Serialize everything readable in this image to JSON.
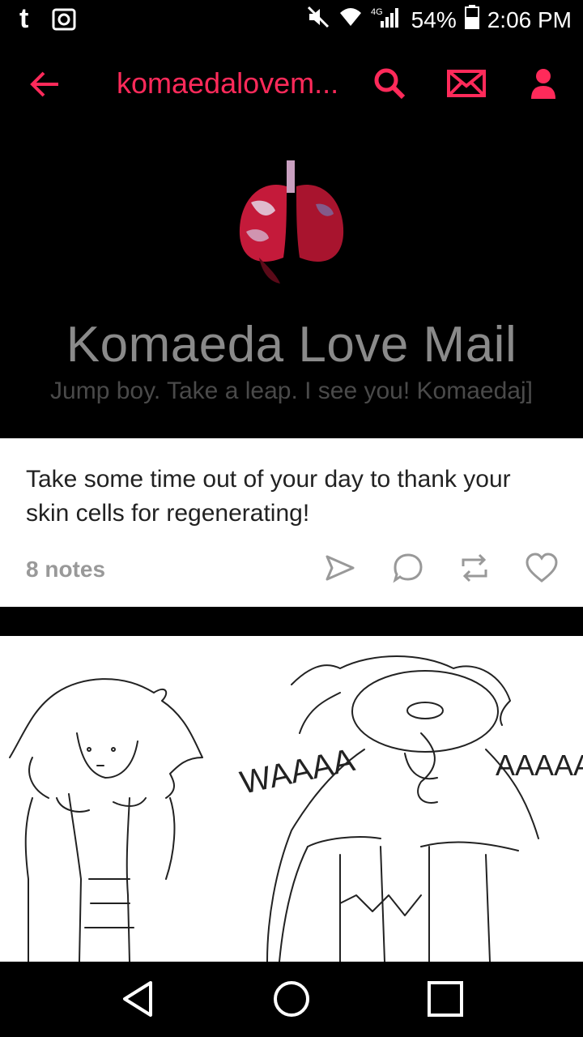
{
  "status_bar": {
    "app_icon": "tumblr-t-icon",
    "battery": "54%",
    "time": "2:06 PM"
  },
  "app_bar": {
    "title": "komaedalovem...",
    "accent": "#ff2a5a"
  },
  "blog": {
    "title": "Komaeda Love Mail",
    "description": "Jump boy. Take a leap. I see you! Komaedaj]"
  },
  "post": {
    "text": "Take some time out of your day to thank your skin cells for regenerating!",
    "notes": "8 notes"
  },
  "drawing": {
    "caption_left": "WAAAA",
    "caption_right": "AAAAA"
  }
}
